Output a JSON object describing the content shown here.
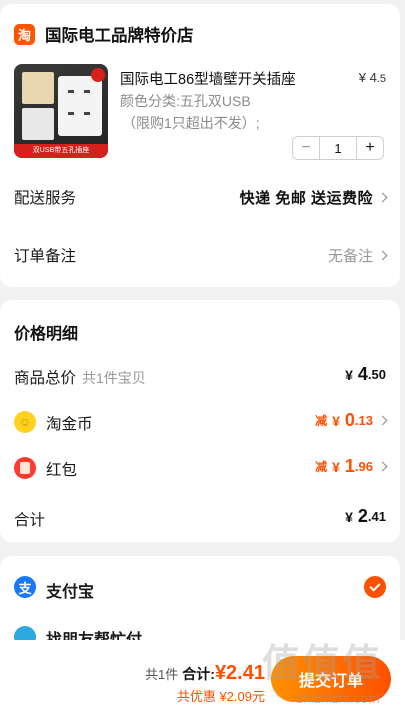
{
  "shop": {
    "logo_char": "淘",
    "name": "国际电工品牌特价店"
  },
  "product": {
    "title": "国际电工86型墙壁开关插座",
    "sku": "颜色分类:五孔双USB",
    "note": "（限购1只超出不发）;",
    "price_currency": "¥",
    "price_int": "4",
    "price_dec": ".5",
    "thumb_banner": "双USB带五孔插座",
    "quantity": "1"
  },
  "delivery": {
    "label": "配送服务",
    "value": "快递 免邮 送运费险"
  },
  "remark": {
    "label": "订单备注",
    "value": "无备注"
  },
  "pricing": {
    "title": "价格明细",
    "total_label": "商品总价",
    "total_sub": "共1件宝贝",
    "total_cur": "¥",
    "total_int": "4",
    "total_dec": ".50",
    "coin_label": "淘金币",
    "coin_pre": "减",
    "coin_cur": "¥",
    "coin_int": "0",
    "coin_dec": ".13",
    "hongbao_label": "红包",
    "hongbao_pre": "减",
    "hongbao_cur": "¥",
    "hongbao_int": "1",
    "hongbao_dec": ".96",
    "sum_label": "合计",
    "sum_cur": "¥",
    "sum_int": "2",
    "sum_dec": ".41"
  },
  "payment": {
    "alipay_char": "支",
    "alipay_label": "支付宝",
    "friend_label": "找朋友帮忙付"
  },
  "bottom": {
    "count": "共1件",
    "sum_label": "合计:",
    "sum_amount": "¥2.41",
    "discount": "共优惠 ¥2.09元",
    "submit_label": "提交订单"
  },
  "watermark": {
    "text": "值值值",
    "url": "zhizhizhi.com"
  },
  "colors": {
    "accent": "#ff5000",
    "brand": "#ff5500",
    "alipay": "#1677ff"
  }
}
